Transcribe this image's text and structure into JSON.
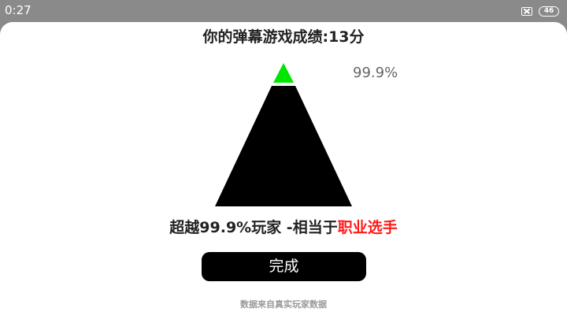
{
  "status_bar": {
    "time": "0:27",
    "sim_icon": "sim-card-x-icon",
    "battery_level": "46"
  },
  "result": {
    "title": "你的弹幕游戏成绩:13分",
    "percent_label": "99.9%",
    "rank_prefix": "超越99.9%玩家 -相当于",
    "rank_level": "职业选手",
    "done_label": "完成",
    "data_source": "数据来自真实玩家数据"
  },
  "pyramid": {
    "tip_color": "#00e600",
    "base_color": "#000000",
    "highlight_fraction": 0.999
  },
  "colors": {
    "accent_red": "#ff1a1a",
    "status_bar_bg": "#8a8a8a"
  }
}
